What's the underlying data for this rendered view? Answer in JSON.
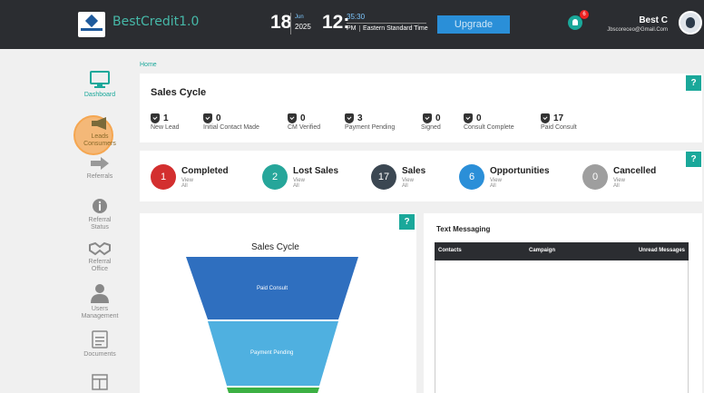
{
  "header": {
    "brand": "BestCredit1.0",
    "date_day": "18",
    "date_month": "Jun",
    "date_year": "2025",
    "time_hour": "12:",
    "time_minute": "35:30",
    "time_ampm": "PM",
    "timezone": "Eastern Standard Time",
    "upgrade_label": "Upgrade",
    "notification_count": "6",
    "user_name": "Best C",
    "user_email": "Jbscoreceo@Gmail.Com",
    "accent_color": "#1aa89a"
  },
  "sidebar": {
    "items": [
      {
        "label": "Dashboard",
        "icon": "monitor-icon"
      },
      {
        "label": "Leads\nConsumers",
        "icon": "megaphone-icon"
      },
      {
        "label": "Referrals",
        "icon": "arrow-right-icon"
      },
      {
        "label": "Referral\nStatus",
        "icon": "info-icon"
      },
      {
        "label": "Referral\nOffice",
        "icon": "handshake-icon"
      },
      {
        "label": "Users\nManagement",
        "icon": "user-icon"
      },
      {
        "label": "Documents",
        "icon": "document-icon"
      },
      {
        "label": "",
        "icon": "layout-icon"
      }
    ]
  },
  "breadcrumb": "Home",
  "help_label": "?",
  "sales_cycle": {
    "title": "Sales Cycle",
    "stages": [
      {
        "count": "1",
        "label": "New Lead"
      },
      {
        "count": "0",
        "label": "Initial Contact Made"
      },
      {
        "count": "0",
        "label": "CM Verified"
      },
      {
        "count": "3",
        "label": "Payment Pending"
      },
      {
        "count": "0",
        "label": "Signed"
      },
      {
        "count": "0",
        "label": "Consult Complete"
      },
      {
        "count": "17",
        "label": "Paid Consult"
      }
    ]
  },
  "statuses": [
    {
      "count": "1",
      "title": "Completed",
      "link": "View All",
      "color": "#d32f2f"
    },
    {
      "count": "2",
      "title": "Lost Sales",
      "link": "View All",
      "color": "#26a69a"
    },
    {
      "count": "17",
      "title": "Sales",
      "link": "View All",
      "color": "#3b4752"
    },
    {
      "count": "6",
      "title": "Opportunities",
      "link": "View All",
      "color": "#2b8fd8"
    },
    {
      "count": "0",
      "title": "Cancelled",
      "link": "View All",
      "color": "#9e9e9e"
    }
  ],
  "funnel": {
    "title": "Sales Cycle",
    "segments": [
      {
        "label": "Paid Consult",
        "color": "#2f6fbf"
      },
      {
        "label": "Payment Pending",
        "color": "#4fb0e0"
      },
      {
        "label": "",
        "color": "#3cb043"
      }
    ]
  },
  "text_messaging": {
    "title": "Text Messaging",
    "columns": [
      "Contacts",
      "Campaign",
      "Unread Messages"
    ]
  }
}
